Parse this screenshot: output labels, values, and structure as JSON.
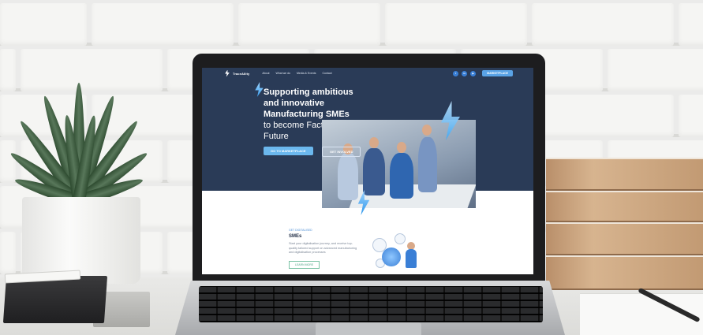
{
  "site": {
    "logo_text": "TraceAIlity",
    "nav": [
      "About",
      "What we do",
      "Media & Events",
      "Contact"
    ],
    "social_icons": [
      "twitter-icon",
      "linkedin-icon",
      "youtube-icon"
    ],
    "social_glyphs": [
      "t",
      "in",
      "▶"
    ],
    "marketplace_label": "MARKETPLACE"
  },
  "hero": {
    "line1": "Supporting ambitious",
    "line2": "and innovative",
    "line3": "Manufacturing SMEs",
    "line4": "to become Factories of the",
    "line5": "Future",
    "cta_primary": "GO TO MARKETPLACE",
    "cta_secondary": "GET INVOLVED"
  },
  "section": {
    "kicker": "GET DIGITALISED",
    "title": "SMEs",
    "body": "Start your digitalisation journey, and receive top-quality tailored support on advanced manufacturing and digitalisation processes",
    "button": "LEARN MORE"
  },
  "colors": {
    "hero_bg": "#2a3b57",
    "accent_blue": "#5aa3e6",
    "accent_green": "#4fa587"
  }
}
